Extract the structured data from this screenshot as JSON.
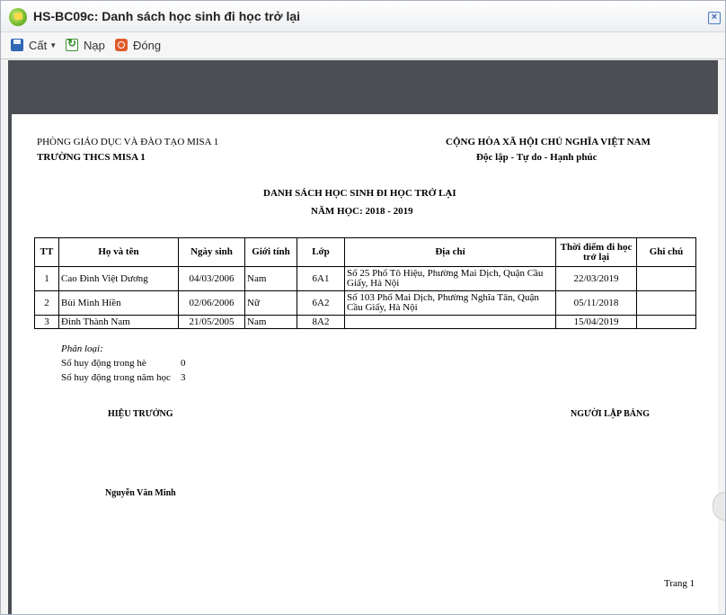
{
  "window": {
    "title": "HS-BC09c: Danh sách học sinh đi học trở lại"
  },
  "toolbar": {
    "cut_label": "Cất",
    "reload_label": "Nạp",
    "close_label": "Đóng"
  },
  "report": {
    "org_left_line1": "PHÒNG GIÁO DỤC VÀ ĐÀO TẠO MISA 1",
    "org_left_line2": "TRƯỜNG THCS MISA 1",
    "org_right_line1": "CỘNG HÒA XÃ HỘI CHỦ NGHĨA VIỆT NAM",
    "org_right_line2": "Độc lập - Tự do - Hạnh phúc",
    "title": "DANH SÁCH HỌC SINH ĐI HỌC TRỞ LẠI",
    "school_year": "NĂM HỌC: 2018 - 2019",
    "columns": [
      "TT",
      "Họ và tên",
      "Ngày sinh",
      "Giới tính",
      "Lớp",
      "Địa chỉ",
      "Thời điểm đi học trở lại",
      "Ghi chú"
    ],
    "rows": [
      {
        "tt": "1",
        "name": "Cao Đình Việt Dương",
        "dob": "04/03/2006",
        "gender": "Nam",
        "class": "6A1",
        "address": "Số 25 Phố Tô Hiệu, Phường Mai Dịch, Quận Cầu Giấy, Hà Nội",
        "return_date": "22/03/2019",
        "note": ""
      },
      {
        "tt": "2",
        "name": "Bùi Minh Hiền",
        "dob": "02/06/2006",
        "gender": "Nữ",
        "class": "6A2",
        "address": "Số 103 Phố Mai Dịch, Phường Nghĩa Tân, Quận Cầu Giấy, Hà Nội",
        "return_date": "05/11/2018",
        "note": ""
      },
      {
        "tt": "3",
        "name": "Đinh Thành Nam",
        "dob": "21/05/2005",
        "gender": "Nam",
        "class": "8A2",
        "address": "",
        "return_date": "15/04/2019",
        "note": ""
      }
    ],
    "summary": {
      "heading": "Phân loại:",
      "summer_label": "Số huy động trong hè",
      "summer_value": "0",
      "year_label": "Số huy động trong năm học",
      "year_value": "3"
    },
    "signature_left_title": "HIỆU TRƯỞNG",
    "signature_right_title": "NGƯỜI LẬP BẢNG",
    "signature_left_name": "Nguyễn Văn Minh",
    "page_label": "Trang 1"
  }
}
